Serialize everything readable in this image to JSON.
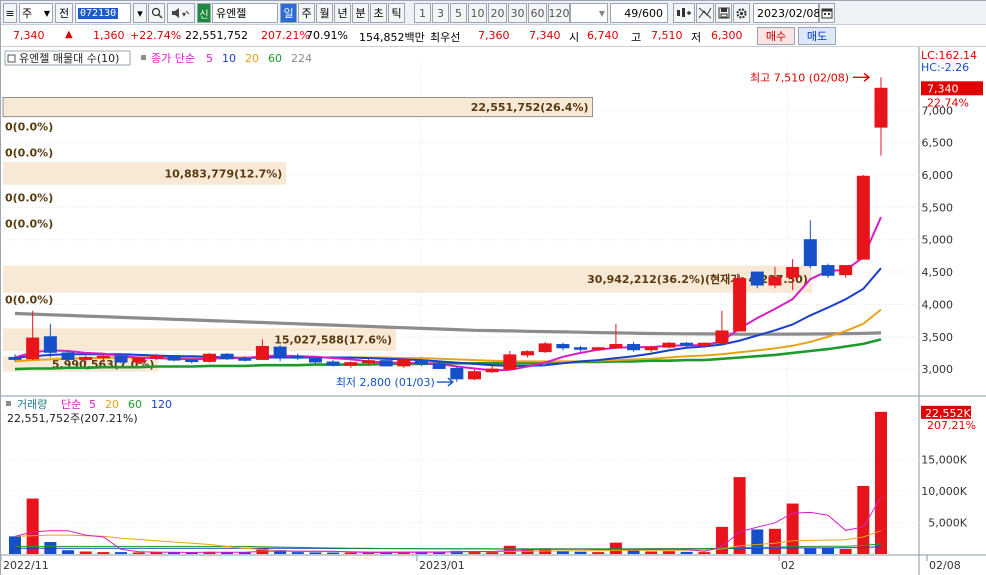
{
  "toolbar": {
    "market": "주",
    "prev_label": "전",
    "code": "072130",
    "name_tag": "신",
    "stock_name": "유엔젤",
    "periods": [
      "일",
      "주",
      "월",
      "년",
      "분",
      "초",
      "틱"
    ],
    "active_period": "일",
    "minutes": [
      "1",
      "3",
      "5",
      "10",
      "20",
      "30",
      "60",
      "120"
    ],
    "count": "49/600",
    "date": "2023/02/08"
  },
  "quote": {
    "price": "7,340",
    "arrow": "▲",
    "change": "1,360",
    "change_pct": "+22.74%",
    "volume": "22,551,752",
    "volume_ratio": "207.21%",
    "turnover_rate": "70.91%",
    "amount": "154,852백만",
    "best_label": "최우선",
    "ask": "7,360",
    "bid": "7,340",
    "open_label": "시",
    "open": "6,740",
    "high_label": "고",
    "high": "7,510",
    "low_label": "저",
    "low": "6,300",
    "buy_button": "매수",
    "sell_button": "매도"
  },
  "price_panel": {
    "legend_title": "유엔젤 매물대 수(10)",
    "ma_label": "종가 단순",
    "ma_periods": [
      "5",
      "10",
      "20",
      "60",
      "224"
    ],
    "ma_colors": [
      "#d81cc9",
      "#1a3fcf",
      "#e8a317",
      "#1c9a2a",
      "#8c8c8c"
    ],
    "lc_label": "LC:162.14",
    "hc_label": "HC:-2.26",
    "price_tag": "7,340",
    "pct_tag": "22.74%",
    "high_annot": "최고 7,510 (02/08)",
    "low_annot": "최저 2,800 (01/03)",
    "y_ticks": [
      "7,000",
      "6,500",
      "6,000",
      "5,500",
      "5,000",
      "4,500",
      "4,000",
      "3,500",
      "3,000"
    ]
  },
  "volume_profile": [
    {
      "label": "22,551,752(26.4%)",
      "price_lo": 6900,
      "price_hi": 7200,
      "len": 0.645
    },
    {
      "label": "0(0.0%)",
      "price_lo": 6600,
      "price_hi": 6900,
      "len": 0
    },
    {
      "label": "0(0.0%)",
      "price_lo": 6200,
      "price_hi": 6500,
      "len": 0
    },
    {
      "label": "10,883,779(12.7%)",
      "price_lo": 5850,
      "price_hi": 6200,
      "len": 0.31
    },
    {
      "label": "0(0.0%)",
      "price_lo": 5500,
      "price_hi": 5800,
      "len": 0
    },
    {
      "label": "0(0.0%)",
      "price_lo": 5100,
      "price_hi": 5400,
      "len": 0
    },
    {
      "label": "30,942,212(36.2%)(현재가: 4,227.50)",
      "price_lo": 4180,
      "price_hi": 4600,
      "len": 0.885
    },
    {
      "label": "0(0.0%)",
      "price_lo": 3950,
      "price_hi": 4200,
      "len": 0
    },
    {
      "label": "15,027,588(17.6%)",
      "price_lo": 3280,
      "price_hi": 3630,
      "len": 0.43
    },
    {
      "label": "5,990,563(7.0%)",
      "price_lo": 2960,
      "price_hi": 3200,
      "len": 0.17
    }
  ],
  "volume_panel": {
    "legend_title": "거래량",
    "ma_label": "단순",
    "ma_periods": [
      "5",
      "20",
      "60",
      "120"
    ],
    "ma_colors": [
      "#d81cc9",
      "#e8a317",
      "#1c9a2a",
      "#1a3fcf"
    ],
    "vol_text": "22,551,752주(207.21%)",
    "vol_tag": "22,552K",
    "pct_tag": "207.21%",
    "y_ticks": [
      "15,000K",
      "10,000K",
      "5,000K"
    ]
  },
  "x_labels": [
    "2022/11",
    "2023/01",
    "02",
    "02/08"
  ],
  "chart_data": {
    "type": "candlestick",
    "ylim": [
      2600,
      7700
    ],
    "vol_ylim": [
      0,
      23000
    ],
    "candles": [
      [
        3180,
        3230,
        3120,
        3150,
        2800
      ],
      [
        3160,
        3900,
        3140,
        3480,
        8800
      ],
      [
        3500,
        3700,
        3180,
        3260,
        1900
      ],
      [
        3250,
        3280,
        3120,
        3150,
        600
      ],
      [
        3150,
        3210,
        3100,
        3180,
        400
      ],
      [
        3180,
        3230,
        3110,
        3200,
        300
      ],
      [
        3200,
        3220,
        3090,
        3110,
        300
      ],
      [
        3110,
        3190,
        3080,
        3170,
        250
      ],
      [
        3170,
        3230,
        3140,
        3210,
        240
      ],
      [
        3210,
        3220,
        3120,
        3140,
        240
      ],
      [
        3140,
        3160,
        3090,
        3120,
        240
      ],
      [
        3120,
        3250,
        3100,
        3230,
        350
      ],
      [
        3230,
        3250,
        3140,
        3160,
        300
      ],
      [
        3160,
        3200,
        3120,
        3150,
        260
      ],
      [
        3150,
        3460,
        3140,
        3350,
        900
      ],
      [
        3340,
        3370,
        3120,
        3200,
        600
      ],
      [
        3200,
        3240,
        3140,
        3170,
        300
      ],
      [
        3170,
        3180,
        3080,
        3110,
        250
      ],
      [
        3110,
        3140,
        3040,
        3060,
        230
      ],
      [
        3060,
        3120,
        3020,
        3100,
        220
      ],
      [
        3100,
        3160,
        3060,
        3130,
        220
      ],
      [
        3130,
        3150,
        3040,
        3050,
        240
      ],
      [
        3050,
        3170,
        3020,
        3140,
        400
      ],
      [
        3140,
        3160,
        3050,
        3080,
        300
      ],
      [
        3080,
        3100,
        3000,
        3010,
        300
      ],
      [
        3010,
        3040,
        2800,
        2850,
        500
      ],
      [
        2850,
        3000,
        2830,
        2960,
        450
      ],
      [
        2960,
        3060,
        2940,
        3000,
        300
      ],
      [
        3000,
        3280,
        2990,
        3220,
        1300
      ],
      [
        3220,
        3290,
        3180,
        3270,
        700
      ],
      [
        3270,
        3420,
        3250,
        3390,
        900
      ],
      [
        3380,
        3410,
        3290,
        3330,
        500
      ],
      [
        3330,
        3360,
        3270,
        3320,
        350
      ],
      [
        3320,
        3340,
        3280,
        3330,
        300
      ],
      [
        3330,
        3700,
        3310,
        3380,
        1800
      ],
      [
        3380,
        3420,
        3270,
        3300,
        700
      ],
      [
        3300,
        3360,
        3260,
        3340,
        400
      ],
      [
        3340,
        3420,
        3320,
        3400,
        450
      ],
      [
        3400,
        3420,
        3330,
        3370,
        350
      ],
      [
        3370,
        3410,
        3330,
        3400,
        300
      ],
      [
        3400,
        3900,
        3380,
        3590,
        4300
      ],
      [
        3590,
        4450,
        4050,
        4400,
        12200
      ],
      [
        4500,
        4500,
        4250,
        4300,
        3900
      ],
      [
        4300,
        4580,
        4250,
        4420,
        4000
      ],
      [
        4420,
        4700,
        4220,
        4570,
        8000
      ],
      [
        5000,
        5300,
        4560,
        4600,
        900
      ],
      [
        4600,
        4630,
        4410,
        4450,
        1000
      ],
      [
        4460,
        4600,
        4410,
        4600,
        800
      ],
      [
        4700,
        6000,
        4700,
        5980,
        10800
      ],
      [
        6740,
        7510,
        6300,
        7340,
        22552
      ]
    ],
    "ma5": [
      3180,
      3260,
      3290,
      3280,
      3250,
      3240,
      3200,
      3180,
      3170,
      3160,
      3150,
      3160,
      3170,
      3170,
      3200,
      3210,
      3200,
      3190,
      3170,
      3150,
      3120,
      3100,
      3100,
      3090,
      3080,
      3040,
      3010,
      2980,
      2990,
      3040,
      3100,
      3190,
      3250,
      3300,
      3330,
      3340,
      3340,
      3360,
      3370,
      3370,
      3430,
      3630,
      3790,
      3930,
      4080,
      4390,
      4520,
      4530,
      4730,
      5350
    ],
    "ma10": [
      3180,
      3200,
      3220,
      3230,
      3230,
      3230,
      3230,
      3220,
      3210,
      3200,
      3200,
      3190,
      3180,
      3170,
      3180,
      3180,
      3180,
      3180,
      3180,
      3180,
      3170,
      3160,
      3150,
      3140,
      3120,
      3100,
      3080,
      3060,
      3050,
      3050,
      3060,
      3090,
      3120,
      3140,
      3170,
      3200,
      3240,
      3290,
      3330,
      3350,
      3380,
      3440,
      3520,
      3600,
      3690,
      3830,
      3950,
      4080,
      4240,
      4560
    ],
    "ma20": [
      3120,
      3140,
      3150,
      3160,
      3170,
      3170,
      3180,
      3180,
      3180,
      3180,
      3180,
      3180,
      3180,
      3180,
      3180,
      3180,
      3180,
      3180,
      3180,
      3180,
      3180,
      3180,
      3170,
      3170,
      3160,
      3150,
      3140,
      3130,
      3120,
      3120,
      3120,
      3120,
      3120,
      3130,
      3140,
      3150,
      3160,
      3180,
      3200,
      3210,
      3230,
      3260,
      3290,
      3320,
      3360,
      3420,
      3500,
      3590,
      3700,
      3920
    ],
    "ma60": [
      3000,
      3010,
      3010,
      3020,
      3020,
      3030,
      3030,
      3030,
      3040,
      3040,
      3040,
      3050,
      3050,
      3050,
      3060,
      3060,
      3060,
      3070,
      3070,
      3070,
      3070,
      3080,
      3080,
      3080,
      3090,
      3090,
      3090,
      3090,
      3090,
      3090,
      3100,
      3100,
      3110,
      3110,
      3120,
      3120,
      3130,
      3130,
      3140,
      3140,
      3160,
      3180,
      3200,
      3220,
      3250,
      3280,
      3310,
      3350,
      3390,
      3460
    ],
    "ma224": [
      3860,
      3850,
      3840,
      3830,
      3820,
      3810,
      3800,
      3790,
      3780,
      3770,
      3760,
      3750,
      3740,
      3730,
      3720,
      3710,
      3700,
      3690,
      3680,
      3670,
      3660,
      3650,
      3640,
      3630,
      3620,
      3610,
      3600,
      3595,
      3590,
      3585,
      3580,
      3575,
      3570,
      3565,
      3560,
      3555,
      3550,
      3548,
      3546,
      3544,
      3542,
      3540,
      3540,
      3540,
      3541,
      3542,
      3545,
      3548,
      3552,
      3560
    ],
    "vol_ma5": [
      2800,
      3500,
      3700,
      3700,
      3000,
      2700,
      750,
      360,
      300,
      270,
      250,
      270,
      280,
      280,
      420,
      470,
      460,
      460,
      450,
      320,
      240,
      240,
      260,
      270,
      290,
      350,
      390,
      400,
      550,
      650,
      730,
      730,
      750,
      720,
      710,
      740,
      710,
      730,
      720,
      420,
      1150,
      3500,
      4260,
      4950,
      6480,
      6600,
      6160,
      3740,
      4300,
      9000
    ],
    "vol_ma20": [
      2800,
      2900,
      3000,
      3000,
      2900,
      2800,
      2500,
      2300,
      2100,
      1900,
      1700,
      1500,
      1200,
      900,
      700,
      500,
      400,
      380,
      380,
      380,
      370,
      360,
      350,
      350,
      360,
      370,
      380,
      380,
      420,
      450,
      470,
      480,
      500,
      510,
      560,
      580,
      590,
      600,
      620,
      640,
      800,
      1300,
      1500,
      1700,
      2100,
      2150,
      2200,
      2250,
      2700,
      3700
    ],
    "vol_ma60": [
      1200,
      1200,
      1200,
      1200,
      1200,
      1200,
      1200,
      1200,
      1200,
      1200,
      1200,
      1200,
      1200,
      1200,
      1150,
      1100,
      1050,
      1000,
      950,
      900,
      900,
      880,
      870,
      860,
      850,
      840,
      830,
      820,
      820,
      820,
      820,
      830,
      830,
      830,
      840,
      840,
      850,
      850,
      860,
      870,
      900,
      1000,
      1050,
      1100,
      1180,
      1200,
      1220,
      1240,
      1350,
      1600
    ],
    "vol_ma120": [
      900,
      900,
      900,
      900,
      900,
      900,
      900,
      900,
      900,
      900,
      900,
      900,
      900,
      900,
      900,
      900,
      900,
      890,
      880,
      870,
      860,
      850,
      840,
      830,
      820,
      810,
      810,
      800,
      800,
      800,
      800,
      800,
      800,
      800,
      800,
      800,
      810,
      810,
      810,
      820,
      840,
      880,
      900,
      920,
      950,
      960,
      970,
      980,
      1030,
      1150
    ]
  }
}
